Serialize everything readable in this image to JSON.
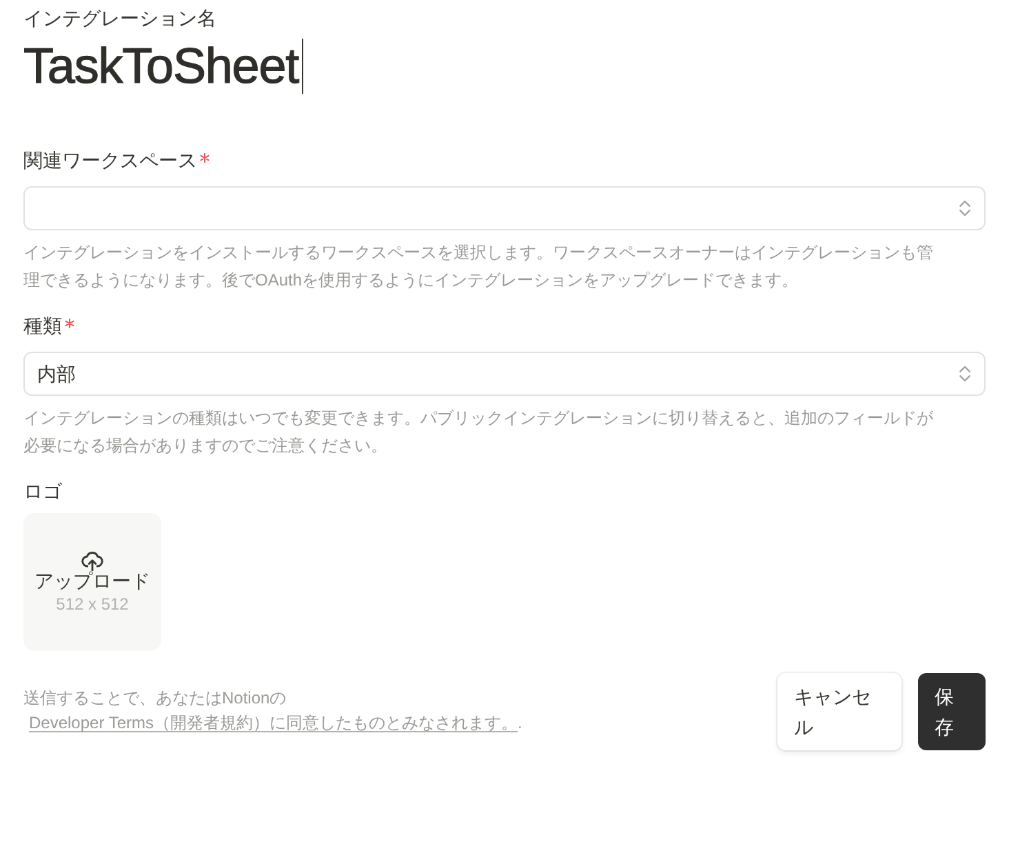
{
  "name_field": {
    "label": "インテグレーション名",
    "value": "TaskToSheet",
    "focused": true
  },
  "fields": [
    {
      "kind": "select",
      "label": "関連ワークスペース",
      "required": true,
      "help": "インテグレーションをインストールするワークスペースを選択します。ワークスペースオーナーはインテグレーションも管理できるようになります。後でOAuthを使用するようにインテグレーションをアップグレードできます。"
    },
    {
      "kind": "select",
      "label": "種類",
      "required": true,
      "value": "内部",
      "help": "インテグレーションの種類はいつでも変更できます。パブリックインテグレーションに切り替えると、追加のフィールドが必要になる場合がありますのでご注意ください。"
    }
  ],
  "logo": {
    "label": "ロゴ",
    "upload_label": "アップロード",
    "size": "512 x 512"
  },
  "footer": {
    "text": "送信することで、あなたはNotionの",
    "link": "Developer Terms（開発者規約）に同意したものとみなされます。",
    "suffix": "."
  },
  "buttons": [
    {
      "kind": "secondary",
      "label": "キャンセル"
    },
    {
      "kind": "primary",
      "label": "保存"
    }
  ]
}
